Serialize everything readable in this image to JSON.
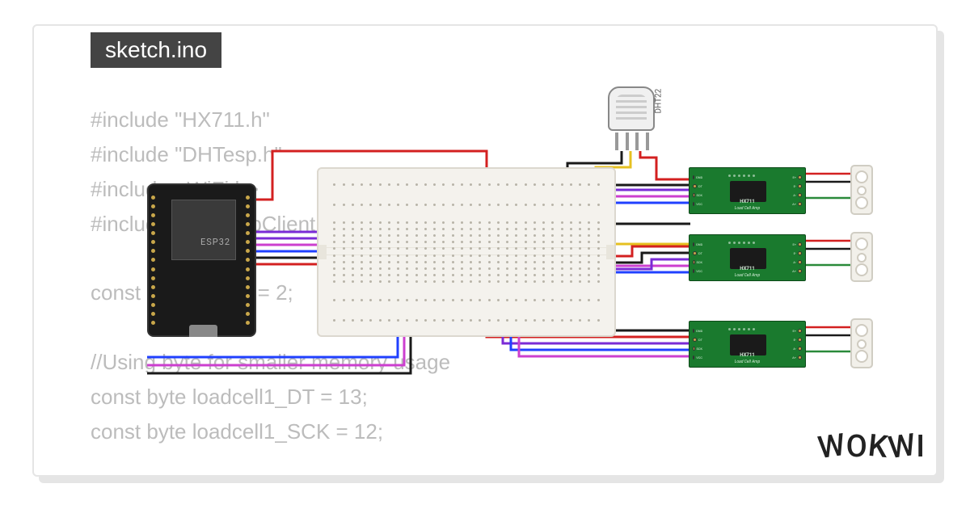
{
  "tab": {
    "filename": "sketch.ino"
  },
  "code": {
    "lines": "#include \"HX711.h\"\n#include \"DHTesp.h\"\n#include <WiFi.h>\n#include <PubSubClient.h>\n\nconst byte dhtPin = 2;\n\n//Using byte for smaller memory usage\nconst byte loadcell1_DT = 13;\nconst byte loadcell1_SCK = 12;"
  },
  "components": {
    "mcu": {
      "label": "ESP32"
    },
    "sensor": {
      "label": "DHT22"
    },
    "hx711": {
      "title": "HX711",
      "subtitle": "Load Cell Amp",
      "left_pins": [
        "GND",
        "DT",
        "SCK",
        "VCC"
      ],
      "right_pins": [
        "E+",
        "E-",
        "A-",
        "A+"
      ]
    }
  },
  "logo": {
    "text": "WOKWI"
  },
  "wire_colors": {
    "vcc": "#d32020",
    "gnd": "#1a1a1a",
    "data1": "#7a2bd6",
    "data2": "#cc3fcf",
    "data3": "#2040ff",
    "dht": "#e6c020",
    "aux": "#ffffff"
  }
}
